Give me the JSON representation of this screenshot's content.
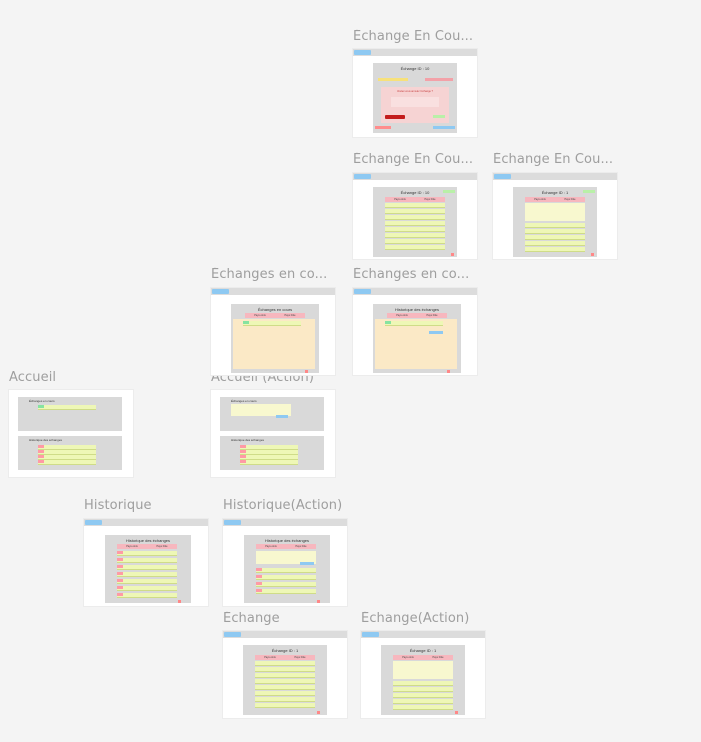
{
  "canvas": {
    "background": "#f4f4f4"
  },
  "frames": [
    {
      "id": "echange-en-cours-confirm",
      "label": "Échange En Cou...",
      "panel_title": "Échange ID : 10",
      "dialog_text": "Voulez-vous annuler l'échange ?"
    },
    {
      "id": "echange-en-cours-list",
      "label": "Échange En Cou...",
      "panel_title": "Échange ID : 10"
    },
    {
      "id": "echange-en-cours-detail",
      "label": "Échange En Cou...",
      "panel_title": "Échange ID : 1"
    },
    {
      "id": "echanges-en-cours",
      "label": "Échanges en co...",
      "panel_title": "Échanges en cours"
    },
    {
      "id": "echanges-en-cours-historique",
      "label": "Échanges en co...",
      "panel_title": "Historique des échanges"
    },
    {
      "id": "accueil",
      "label": "Accueil",
      "panel_titles": [
        "Échanges en cours",
        "Historique des échanges"
      ]
    },
    {
      "id": "accueil-action",
      "label": "Accueil (Action)",
      "panel_titles": [
        "Échanges en cours",
        "Historique des échanges"
      ]
    },
    {
      "id": "historique",
      "label": "Historique",
      "panel_title": "Historique des échanges"
    },
    {
      "id": "historique-action",
      "label": "Historique(Action)",
      "panel_title": "Historique des échanges"
    },
    {
      "id": "echange",
      "label": "Échange",
      "panel_title": "Échange ID : 1"
    },
    {
      "id": "echange-action",
      "label": "Échange(Action)",
      "panel_title": "Échange ID : 1"
    }
  ],
  "table_headers": {
    "col1": "Pays émis",
    "col2": "Pays hôte"
  },
  "colors": {
    "header": "#f7b7be",
    "row": "#eef7b6",
    "panel_gray": "#d9d9d9",
    "accent_blue": "#8ec9f2",
    "cream": "#fbe9c6"
  }
}
